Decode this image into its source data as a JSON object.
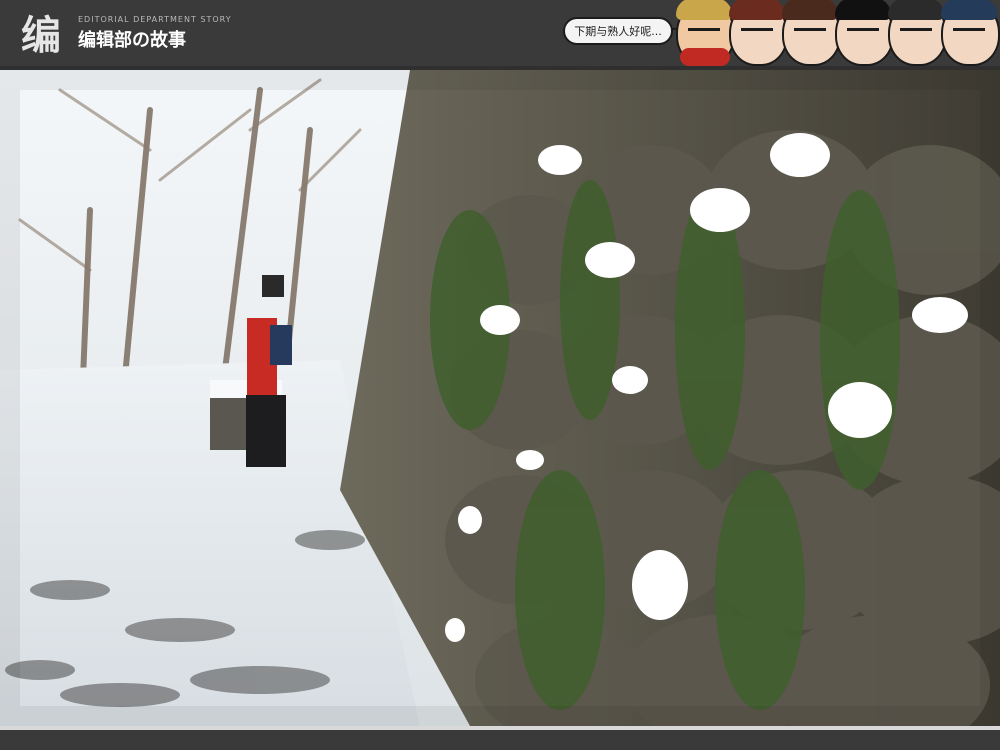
{
  "header": {
    "logo_glyph": "编",
    "logo_subtitle": "EDITORIAL DEPARTMENT STORY",
    "logo_title": "编辑部の故事",
    "speech_bubble": "下期与熟人好呢..."
  },
  "photo": {
    "description_icon": "snowy-stone-wall-photo-icon"
  }
}
